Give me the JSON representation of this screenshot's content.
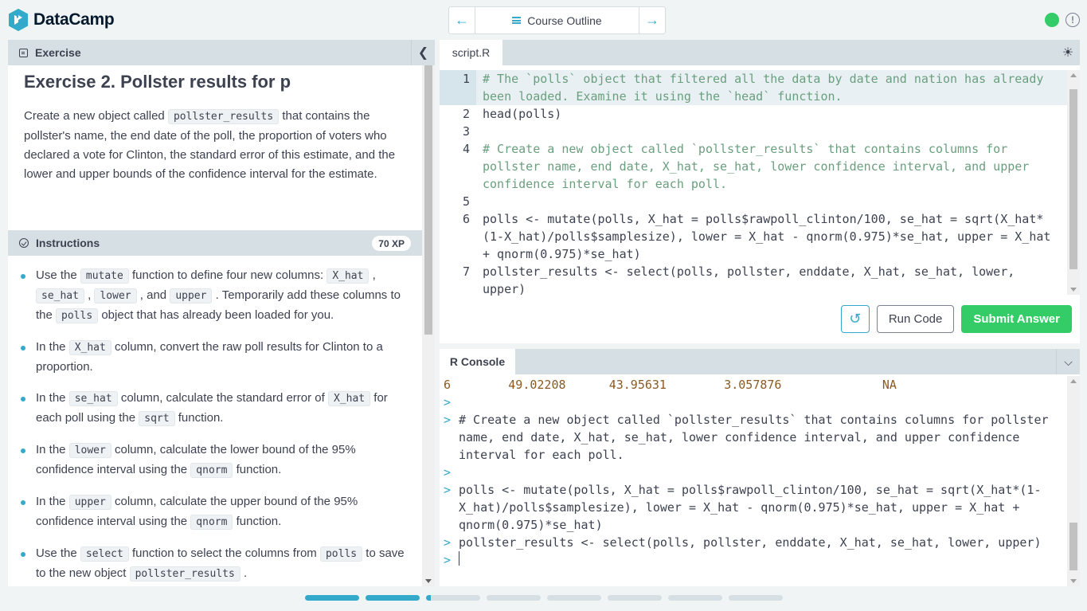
{
  "brand": {
    "name": "DataCamp",
    "accent": "#33aacc",
    "success": "#33cc66"
  },
  "topbar": {
    "outline_label": "Course Outline"
  },
  "exercise": {
    "section_label": "Exercise",
    "title": "Exercise 2. Pollster results for p",
    "desc_1": "Create a new object called ",
    "desc_code": "pollster_results",
    "desc_2": " that contains the pollster's name, the end date of the poll, the proportion of voters who declared a vote for Clinton, the standard error of this estimate, and the lower and upper bounds of the confidence interval for the estimate."
  },
  "instructions": {
    "section_label": "Instructions",
    "xp": "70 XP",
    "items": [
      {
        "parts": [
          "Use the ",
          {
            "c": "mutate"
          },
          " function to define four new columns: ",
          {
            "c": "X_hat"
          },
          " , ",
          {
            "c": "se_hat"
          },
          " , ",
          {
            "c": "lower"
          },
          " , and ",
          {
            "c": "upper"
          },
          " . Temporarily add these columns to the ",
          {
            "c": "polls"
          },
          " object that has already been loaded for you."
        ]
      },
      {
        "parts": [
          "In the ",
          {
            "c": "X_hat"
          },
          " column, convert the raw poll results for Clinton to a proportion."
        ]
      },
      {
        "parts": [
          "In the ",
          {
            "c": "se_hat"
          },
          " column, calculate the standard error of ",
          {
            "c": "X_hat"
          },
          " for each poll using the ",
          {
            "c": "sqrt"
          },
          " function."
        ]
      },
      {
        "parts": [
          "In the ",
          {
            "c": "lower"
          },
          " column, calculate the lower bound of the 95% confidence interval using the ",
          {
            "c": "qnorm"
          },
          " function."
        ]
      },
      {
        "parts": [
          "In the ",
          {
            "c": "upper"
          },
          " column, calculate the upper bound of the 95% confidence interval using the ",
          {
            "c": "qnorm"
          },
          " function."
        ]
      },
      {
        "parts": [
          "Use the ",
          {
            "c": "select"
          },
          " function to select the columns from ",
          {
            "c": "polls"
          },
          " to save to the new object ",
          {
            "c": "pollster_results"
          },
          " ."
        ]
      }
    ]
  },
  "editor": {
    "tab": "script.R",
    "lines": [
      {
        "n": "1",
        "text": "# The `polls` object that filtered all the data by date and nation has already been loaded. Examine it using the `head` function.",
        "comment": true,
        "active": true
      },
      {
        "n": "2",
        "text": "head(polls)",
        "comment": false
      },
      {
        "n": "3",
        "text": "",
        "comment": false
      },
      {
        "n": "4",
        "text": "# Create a new object called `pollster_results` that contains columns for pollster name, end date, X_hat, se_hat, lower confidence interval, and upper confidence interval for each poll.",
        "comment": true
      },
      {
        "n": "5",
        "text": "",
        "comment": false
      },
      {
        "n": "6",
        "text": "polls <- mutate(polls, X_hat = polls$rawpoll_clinton/100, se_hat = sqrt(X_hat*(1-X_hat)/polls$samplesize), lower = X_hat - qnorm(0.975)*se_hat, upper = X_hat + qnorm(0.975)*se_hat)",
        "comment": false
      },
      {
        "n": "7",
        "text": "pollster_results <- select(polls, pollster, enddate, X_hat, se_hat, lower, upper)",
        "comment": false
      }
    ],
    "run_label": "Run Code",
    "submit_label": "Submit Answer"
  },
  "console": {
    "tab": "R Console",
    "output_row": "6        49.02208      43.95631        3.057876              NA",
    "lines": [
      {
        "prompt": ">",
        "text": ""
      },
      {
        "prompt": ">",
        "text": "# Create a new object called `pollster_results` that contains columns for pollster name, end date, X_hat, se_hat, lower confidence interval, and upper confidence interval for each poll."
      },
      {
        "prompt": ">",
        "text": ""
      },
      {
        "prompt": ">",
        "text": "polls <- mutate(polls, X_hat = polls$rawpoll_clinton/100, se_hat = sqrt(X_hat*(1-X_hat)/polls$samplesize), lower = X_hat - qnorm(0.975)*se_hat, upper = X_hat + qnorm(0.975)*se_hat)"
      },
      {
        "prompt": ">",
        "text": "pollster_results <- select(polls, pollster, enddate, X_hat, se_hat, lower, upper)"
      }
    ],
    "input_prompt": ">"
  },
  "progress": {
    "total": 8,
    "completed": 2,
    "current_index": 2
  }
}
